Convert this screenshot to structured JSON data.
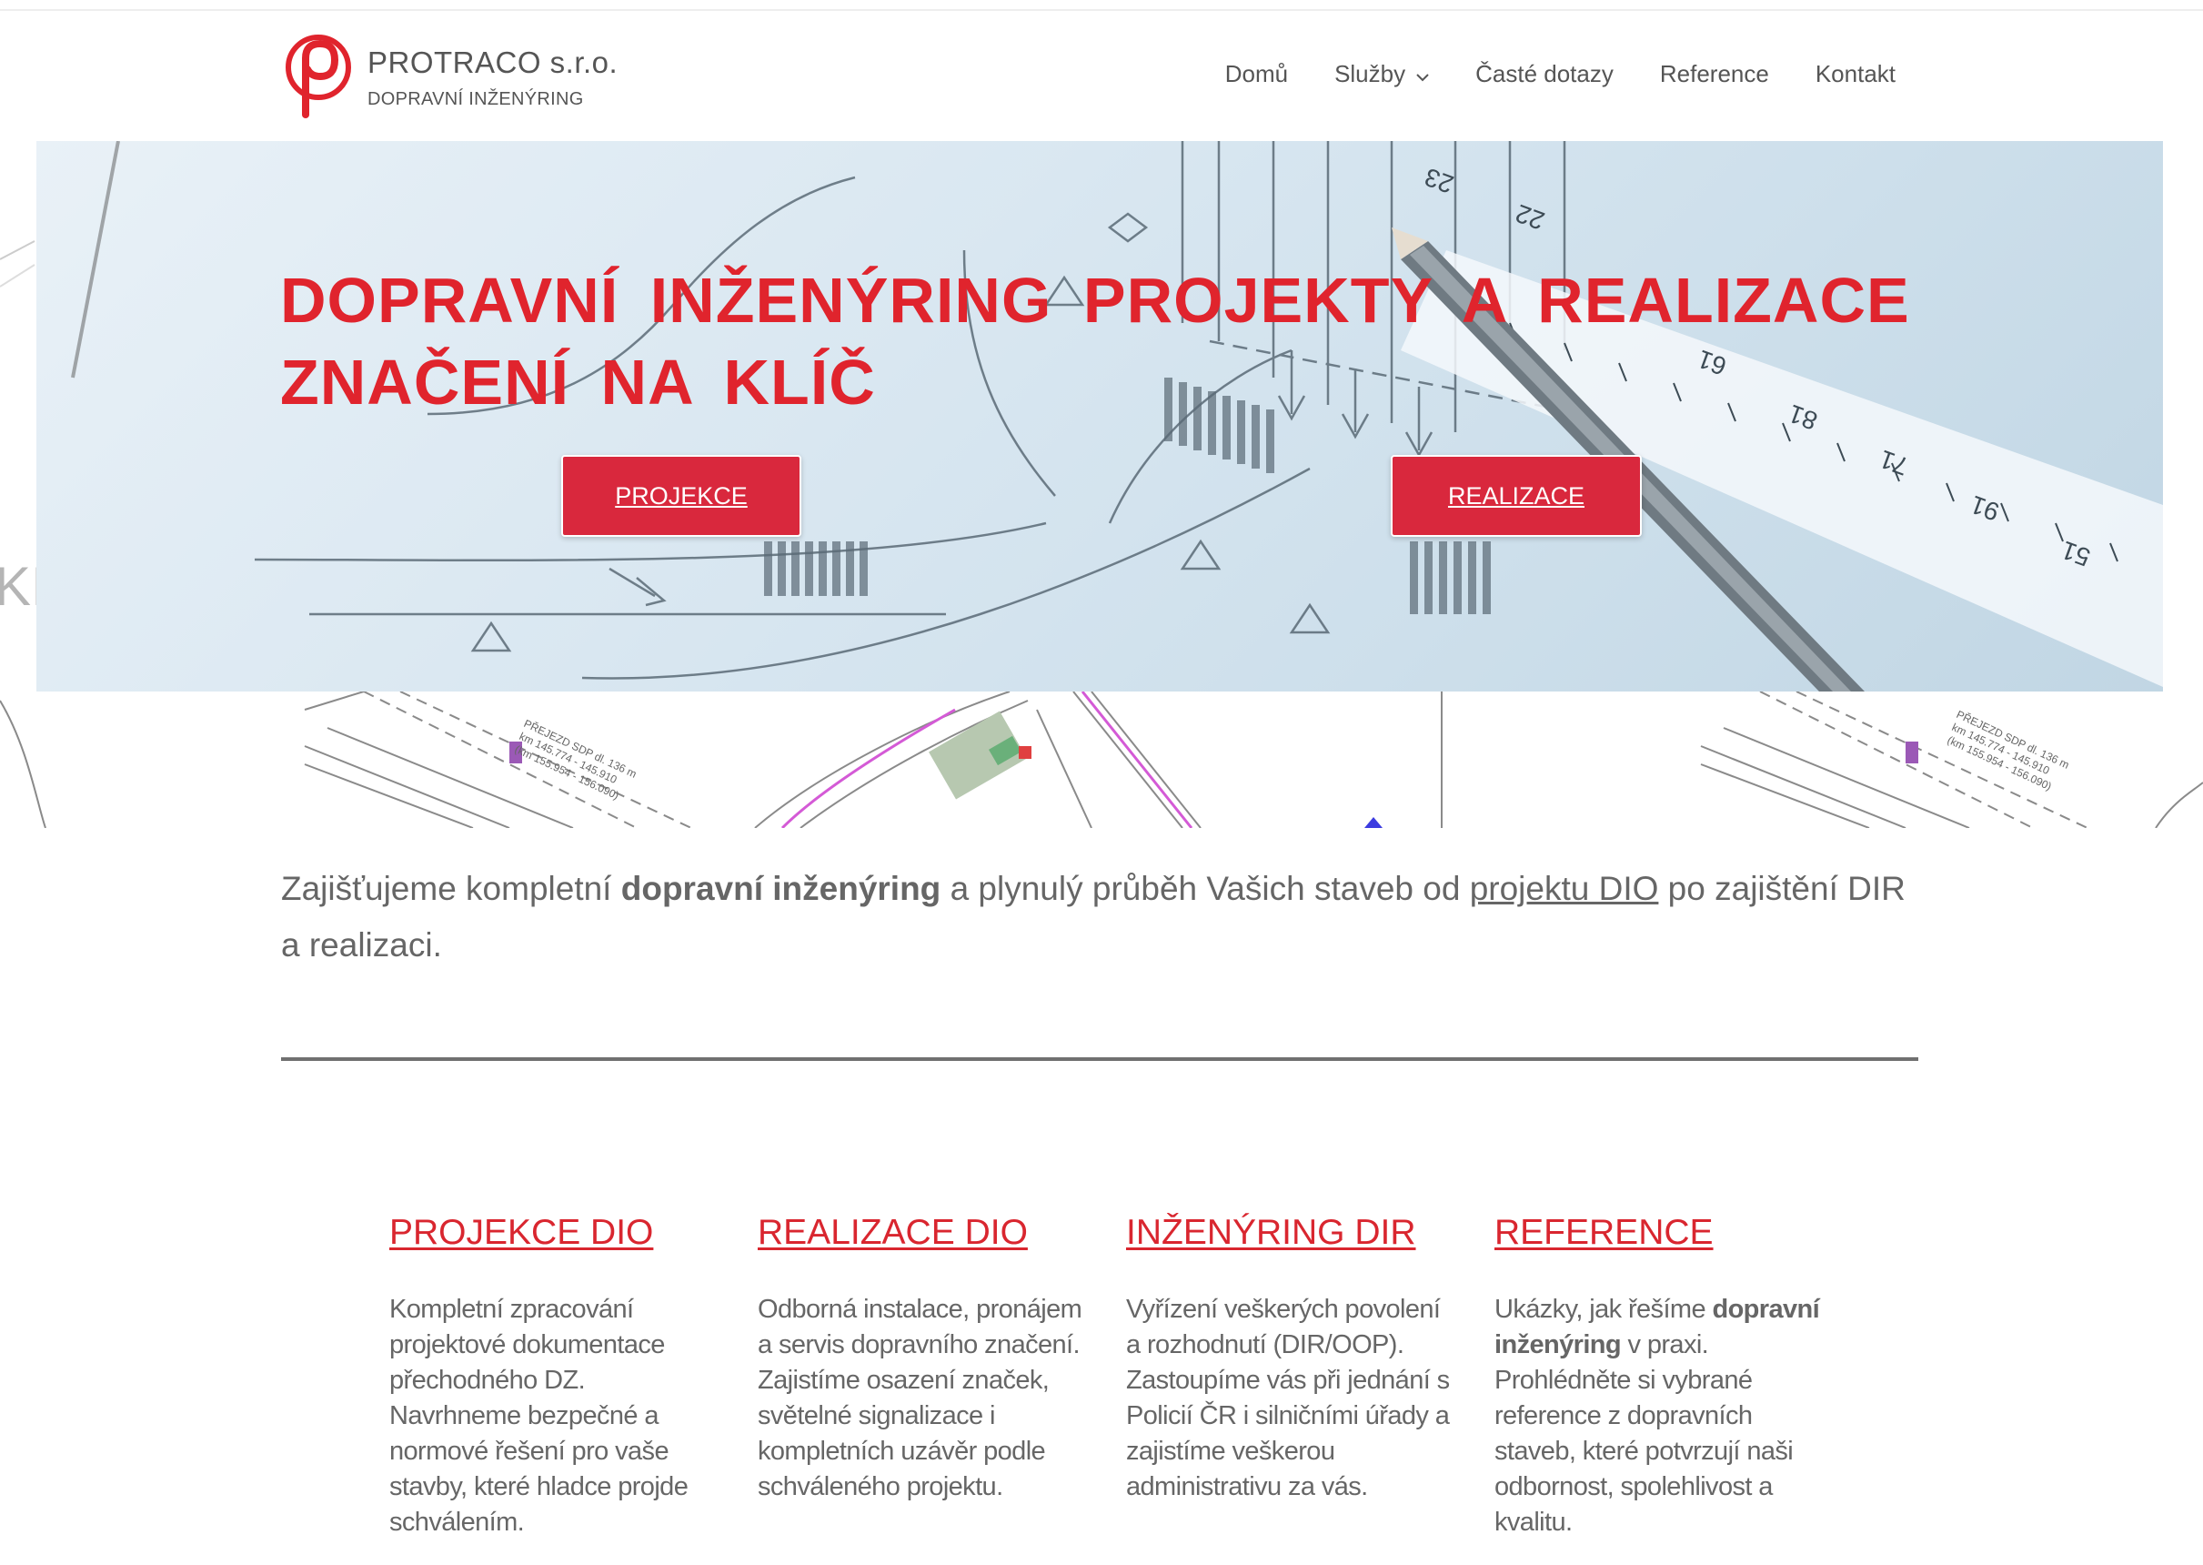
{
  "header": {
    "company_name": "PROTRACO s.r.o.",
    "company_tagline": "DOPRAVNÍ INŽENÝRING",
    "nav": [
      {
        "label": "Domů"
      },
      {
        "label": "Služby"
      },
      {
        "label": "Časté dotazy"
      },
      {
        "label": "Reference"
      },
      {
        "label": "Kontakt"
      }
    ]
  },
  "hero": {
    "title_line1": "DOPRAVNÍ INŽENÝRING PROJEKTY A REALIZACE",
    "title_line2": "ZNAČENÍ NA KLÍČ",
    "button_projekce": "PROJEKCE",
    "button_realizace": "REALIZACE"
  },
  "intro": {
    "part1": "Zajišťujeme kompletní ",
    "bold": "dopravní inženýring",
    "part2": " a plynulý průběh Vašich staveb od ",
    "link": "projektu DIO",
    "part3": " po zajištění DIR a realizaci."
  },
  "services": [
    {
      "title": "PROJEKCE DIO",
      "text": "Kompletní zpracování projektové dokumentace přechodného DZ. Navrhneme bezpečné a normové řešení pro vaše stavby, které hladce projde schválením."
    },
    {
      "title": "REALIZACE DIO",
      "text": "Odborná instalace, pronájem a servis dopravního značení. Zajistíme osazení značek, světelné signalizace i kompletních uzávěr podle schváleného projektu."
    },
    {
      "title": "INŽENÝRING DIR",
      "text": "Vyřízení veškerých povolení a rozhodnutí (DIR/OOP). Zastoupíme vás při jednání s Policií ČR i silničními úřady a zajistíme veškerou administrativu za vás."
    },
    {
      "title": "REFERENCE",
      "text_before": "Ukázky, jak řešíme ",
      "text_bold": "dopravní inženýring",
      "text_after": " v praxi. Prohlédněte si vybrané reference z dopravních staveb, které potvrzují naši odbornost, spolehlivost a kvalitu."
    }
  ],
  "colors": {
    "brand_red": "#e0242d",
    "button_red": "#d9283d",
    "text_gray": "#666666"
  }
}
